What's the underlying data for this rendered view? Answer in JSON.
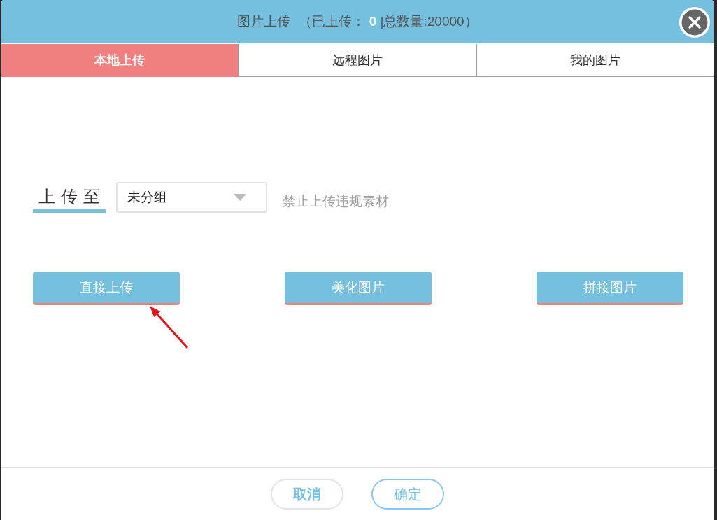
{
  "dialog": {
    "title": "图片上传",
    "upload_status": "（已上传： **0** |总数量:20000）"
  },
  "tabs": [
    {
      "label": "本地上传",
      "selected": true
    },
    {
      "label": "远程图片",
      "selected": false
    },
    {
      "label": "我的图片",
      "selected": false
    }
  ],
  "upload_target": {
    "label": "上传至",
    "group": "未分组",
    "hint": "禁止上传违规素材"
  },
  "upload_buttons": [
    "直接上传",
    "美化图片",
    "拼接图片"
  ],
  "footer_buttons": [
    {
      "label": "取消",
      "kind": "cancel"
    },
    {
      "label": "确定",
      "kind": "confirm"
    }
  ]
}
